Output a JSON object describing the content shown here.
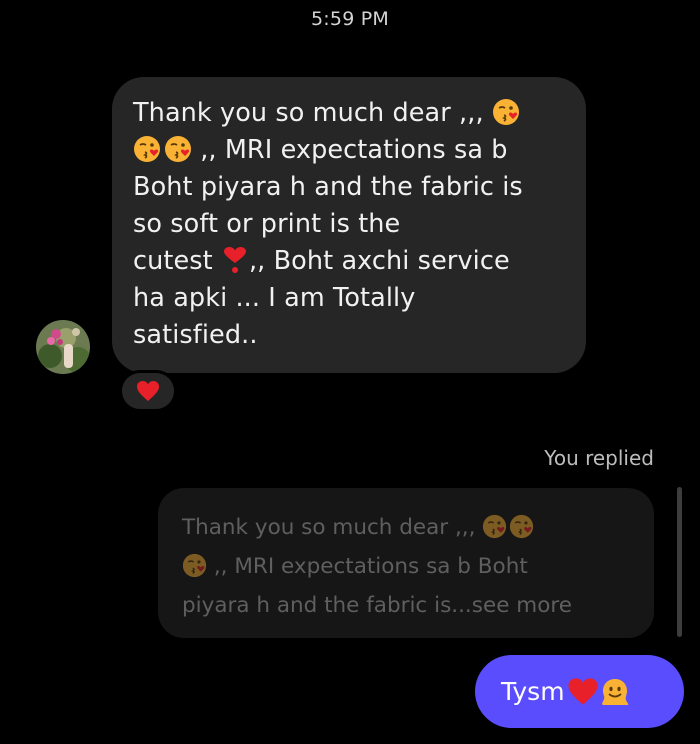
{
  "header": {
    "timestamp": "5:59 PM"
  },
  "contact": {
    "avatar_icon": "avatar-flowers-icon"
  },
  "incoming_message": {
    "lines": [
      "Thank you so much dear ,,, ",
      " ,, MRI expectations sa b",
      "Boht piyara h and the fabric is",
      "so soft or print is the",
      "cutest ",
      ",, Boht axchi service",
      "ha apki ... I am Totally",
      "satisfied.."
    ],
    "emojis": [
      "kissing-face-emoji",
      "heart-exclamation-emoji"
    ],
    "reaction": "red-heart-emoji"
  },
  "reply_label": "You replied",
  "quoted_message": {
    "lines": [
      "Thank you so much dear ,,, ",
      " ,, MRI expectations sa b Boht",
      "piyara h and the fabric is...see more"
    ]
  },
  "outgoing_message": {
    "text": "Tysm ",
    "emojis": [
      "red-heart-emoji",
      "melting-face-emoji"
    ]
  },
  "colors": {
    "background": "#000000",
    "incoming_bubble": "#262626",
    "outgoing_bubble": "#5a4dfd",
    "heart": "#e8202a"
  }
}
